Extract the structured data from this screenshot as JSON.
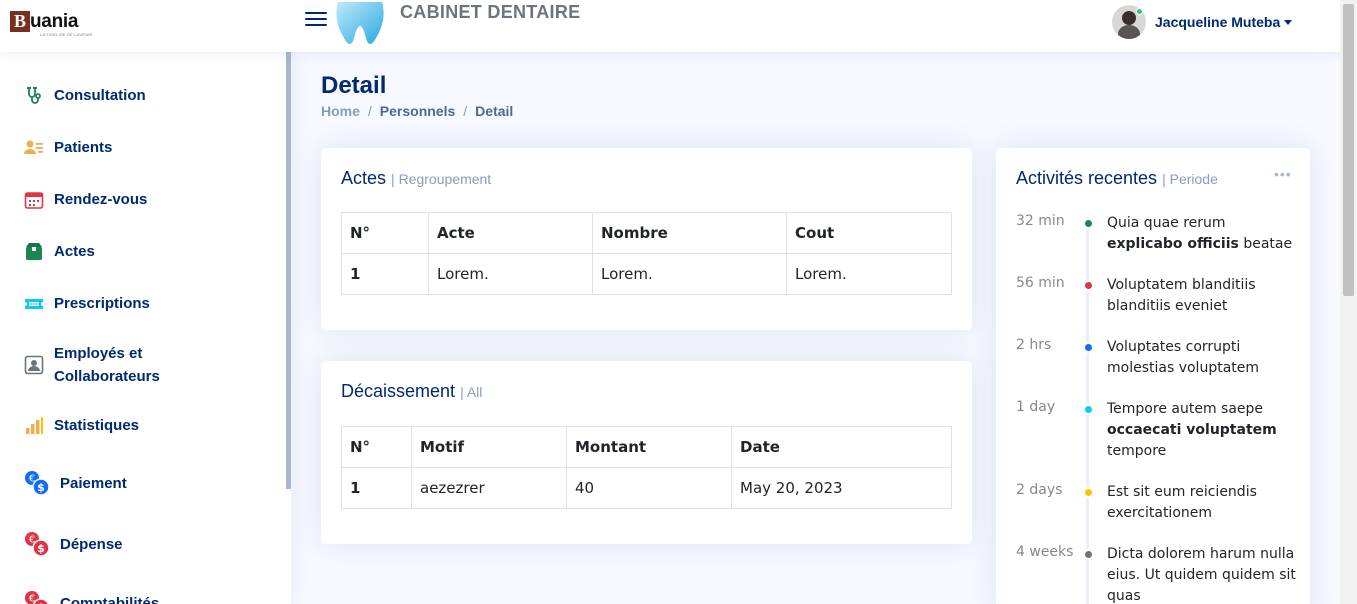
{
  "header": {
    "logo_text": "uania",
    "logo_letter": "B",
    "logo_tagline": "LA FIDELISE DE LAVENIR",
    "brand_title": "CABINET DENTAIRE",
    "user_name": "Jacqueline Muteba"
  },
  "sidebar": {
    "items": [
      {
        "label": "Consultation",
        "icon": "stethoscope-icon",
        "color": "#198754"
      },
      {
        "label": "Patients",
        "icon": "patients-icon",
        "color": "#f0ad4e"
      },
      {
        "label": "Rendez-vous",
        "icon": "calendar-icon",
        "color": "#dc3545"
      },
      {
        "label": "Actes",
        "icon": "box-icon",
        "color": "#198754"
      },
      {
        "label": "Prescriptions",
        "icon": "ticket-icon",
        "color": "#0dcaf0"
      },
      {
        "label": "Employés et Collaborateurs",
        "icon": "person-badge-icon",
        "color": "#6c757d"
      },
      {
        "label": "Statistiques",
        "icon": "bar-chart-icon",
        "color": "#f0ad4e"
      },
      {
        "label": "Paiement",
        "icon": "currency-exchange-icon",
        "color": "#0d6efd"
      },
      {
        "label": "Dépense",
        "icon": "currency-exchange-icon",
        "color": "#dc3545"
      },
      {
        "label": "Comptabilités",
        "icon": "currency-exchange-icon",
        "color": "#dc3545"
      }
    ]
  },
  "page": {
    "title": "Detail",
    "breadcrumb": [
      "Home",
      "Personnels",
      "Detail"
    ],
    "breadcrumb_sep": "/"
  },
  "actes_card": {
    "title": "Actes",
    "subtitle": "| Regroupement",
    "columns": [
      "N°",
      "Acte",
      "Nombre",
      "Cout"
    ],
    "rows": [
      [
        "1",
        "Lorem.",
        "Lorem.",
        "Lorem."
      ]
    ]
  },
  "decaissement_card": {
    "title": "Décaissement",
    "subtitle": "| All",
    "columns": [
      "N°",
      "Motif",
      "Montant",
      "Date"
    ],
    "rows": [
      [
        "1",
        "aezezrer",
        "40",
        "May 20, 2023"
      ]
    ]
  },
  "activity_card": {
    "title": "Activités recentes",
    "subtitle": "| Periode",
    "menu": "•••",
    "items": [
      {
        "time": "32 min",
        "color": "#198754",
        "pre": "Quia quae rerum ",
        "bold": "explicabo officiis",
        "post": " beatae"
      },
      {
        "time": "56 min",
        "color": "#dc3545",
        "pre": "Voluptatem blanditiis blanditiis eveniet",
        "bold": "",
        "post": ""
      },
      {
        "time": "2 hrs",
        "color": "#0d6efd",
        "pre": "Voluptates corrupti molestias voluptatem",
        "bold": "",
        "post": ""
      },
      {
        "time": "1 day",
        "color": "#0dcaf0",
        "pre": "Tempore autem saepe ",
        "bold": "occaecati voluptatem",
        "post": " tempore"
      },
      {
        "time": "2 days",
        "color": "#ffc107",
        "pre": "Est sit eum reiciendis exercitationem",
        "bold": "",
        "post": ""
      },
      {
        "time": "4 weeks",
        "color": "#6c757d",
        "pre": "Dicta dolorem harum nulla eius. Ut quidem quidem sit quas",
        "bold": "",
        "post": ""
      }
    ]
  }
}
